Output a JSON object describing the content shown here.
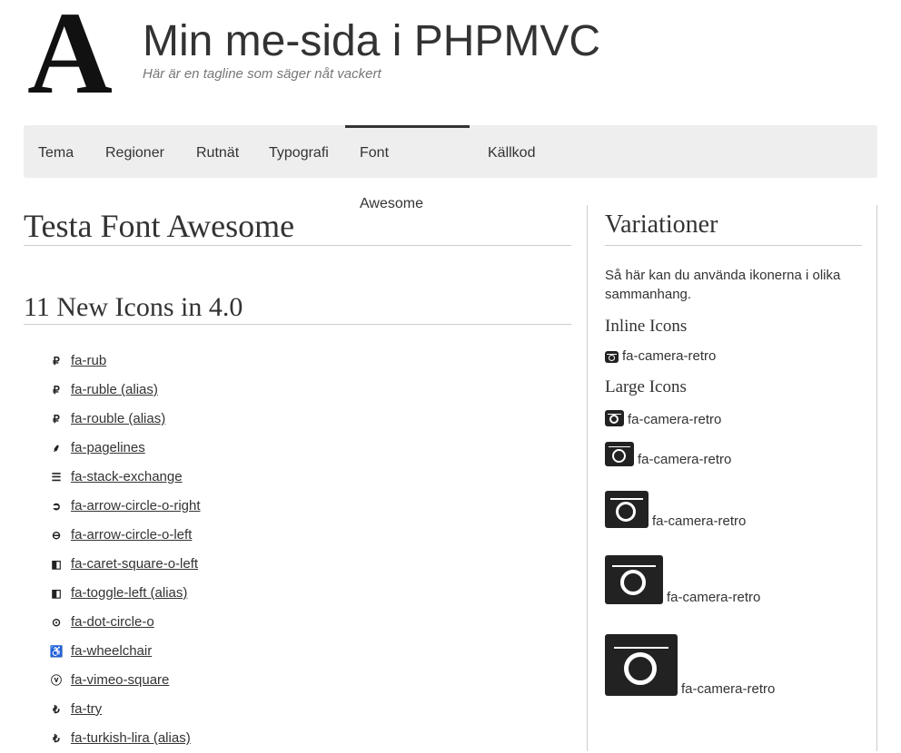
{
  "header": {
    "logo_letter": "A",
    "title": "Min me-sida i PHPMVC",
    "slogan": "Här är en tagline som säger nåt vackert"
  },
  "nav": {
    "items": [
      {
        "label": "Tema"
      },
      {
        "label": "Regioner"
      },
      {
        "label": "Rutnät"
      },
      {
        "label": "Typografi"
      },
      {
        "label": "Font Awesome",
        "selected": true
      },
      {
        "label": "Källkod"
      }
    ]
  },
  "main": {
    "title": "Testa Font Awesome",
    "subtitle": "11 New Icons in 4.0",
    "icons": [
      {
        "icon": "ruble-icon",
        "label": "fa-rub"
      },
      {
        "icon": "ruble-icon",
        "label": "fa-ruble (alias)"
      },
      {
        "icon": "ruble-icon",
        "label": "fa-rouble (alias)"
      },
      {
        "icon": "pagelines-icon",
        "label": "fa-pagelines"
      },
      {
        "icon": "stack-exchange-icon",
        "label": "fa-stack-exchange"
      },
      {
        "icon": "arrow-circle-o-right-icon",
        "label": "fa-arrow-circle-o-right"
      },
      {
        "icon": "arrow-circle-o-left-icon",
        "label": "fa-arrow-circle-o-left"
      },
      {
        "icon": "caret-square-o-left-icon",
        "label": "fa-caret-square-o-left"
      },
      {
        "icon": "toggle-left-icon",
        "label": "fa-toggle-left (alias)"
      },
      {
        "icon": "dot-circle-o-icon",
        "label": "fa-dot-circle-o"
      },
      {
        "icon": "wheelchair-icon",
        "label": "fa-wheelchair"
      },
      {
        "icon": "vimeo-square-icon",
        "label": "fa-vimeo-square"
      },
      {
        "icon": "try-icon",
        "label": "fa-try"
      },
      {
        "icon": "turkish-lira-icon",
        "label": "fa-turkish-lira (alias)"
      }
    ]
  },
  "sidebar": {
    "title": "Variationer",
    "intro": "Så här kan du använda ikonerna i olika sammanhang.",
    "inline_heading": "Inline Icons",
    "inline_label": "fa-camera-retro",
    "large_heading": "Large Icons",
    "large_labels": [
      "fa-camera-retro",
      "fa-camera-retro",
      "fa-camera-retro",
      "fa-camera-retro",
      "fa-camera-retro"
    ]
  }
}
